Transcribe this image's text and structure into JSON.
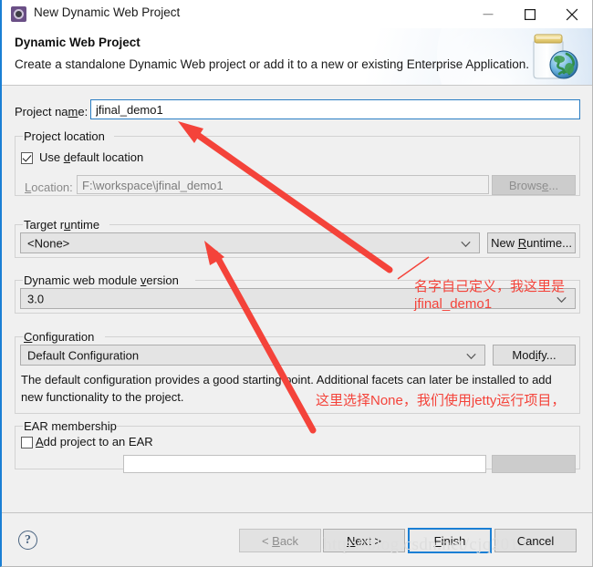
{
  "window": {
    "title": "New Dynamic Web Project",
    "icon": "eclipse-wizard-icon",
    "minimize_label": "minimize-icon",
    "maximize_label": "maximize-icon",
    "close_label": "close-icon"
  },
  "header": {
    "title": "Dynamic Web Project",
    "description": "Create a standalone Dynamic Web project or add it to a new or existing Enterprise Application.",
    "art_icon": "jar-with-globe-icon"
  },
  "form": {
    "project_name_label": "Project name:",
    "project_name_value": "jfinal_demo1",
    "project_location": {
      "legend": "Project location",
      "use_default_label": "Use default location",
      "use_default_checked": true,
      "location_label": "Location:",
      "location_value": "F:\\workspace\\jfinal_demo1",
      "browse_label": "Browse..."
    },
    "target_runtime": {
      "legend": "Target runtime",
      "value": "<None>",
      "new_runtime_label": "New Runtime..."
    },
    "dynamic_web_module_version": {
      "legend": "Dynamic web module version",
      "value": "3.0"
    },
    "configuration": {
      "legend": "Configuration",
      "value": "Default Configuration",
      "modify_label": "Modify...",
      "description_line1": "The default configuration provides a good starting point. Additional facets can later be installed to add",
      "description_line2": "new functionality to the project."
    },
    "ear_membership": {
      "legend": "EAR membership",
      "add_project_label": "Add project to an EAR",
      "add_project_checked": false
    }
  },
  "buttons": {
    "help": "?",
    "back": "< Back",
    "next": "Next >",
    "finish": "Finish",
    "cancel": "Cancel"
  },
  "annotations": {
    "note1_line1": "名字自己定义，我这里是",
    "note1_line2": "jfinal_demo1",
    "note2": "这里选择None，我们使用jetty运行项目，",
    "color": "#f4433a"
  },
  "watermark": "http://blog.csdn.net/cjq2013"
}
